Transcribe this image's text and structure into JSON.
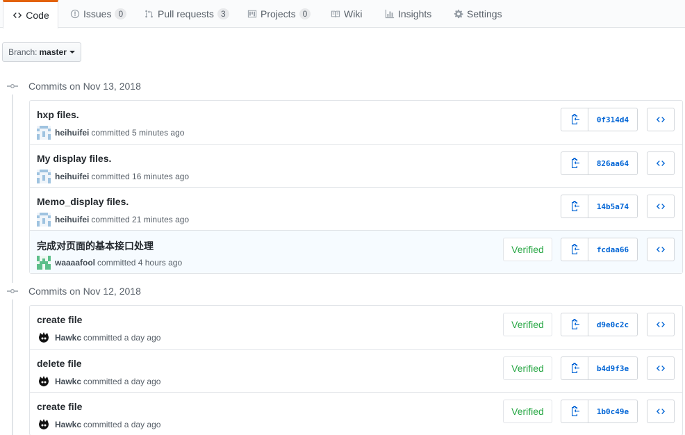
{
  "tabs": {
    "code": "Code",
    "issues": "Issues",
    "issues_count": "0",
    "pulls": "Pull requests",
    "pulls_count": "3",
    "projects": "Projects",
    "projects_count": "0",
    "wiki": "Wiki",
    "insights": "Insights",
    "settings": "Settings"
  },
  "branch": {
    "label": "Branch:",
    "name": "master"
  },
  "groups": [
    {
      "date": "Commits on Nov 13, 2018",
      "commits": [
        {
          "title": "hxp files.",
          "author": "heihuifei",
          "verb": "committed",
          "time": "5 minutes ago",
          "sha": "0f314d4"
        },
        {
          "title": "My display files.",
          "author": "heihuifei",
          "verb": "committed",
          "time": "16 minutes ago",
          "sha": "826aa64"
        },
        {
          "title": "Memo_display files.",
          "author": "heihuifei",
          "verb": "committed",
          "time": "21 minutes ago",
          "sha": "14b5a74"
        },
        {
          "title": "完成对页面的基本接口处理",
          "author": "waaaafool",
          "verb": "committed",
          "time": "4 hours ago",
          "sha": "fcdaa66",
          "verified": "Verified"
        }
      ]
    },
    {
      "date": "Commits on Nov 12, 2018",
      "commits": [
        {
          "title": "create file",
          "author": "Hawkc",
          "verb": "committed",
          "time": "a day ago",
          "sha": "d9e0c2c",
          "verified": "Verified"
        },
        {
          "title": "delete file",
          "author": "Hawkc",
          "verb": "committed",
          "time": "a day ago",
          "sha": "b4d9f3e",
          "verified": "Verified"
        },
        {
          "title": "create file",
          "author": "Hawkc",
          "verb": "committed",
          "time": "a day ago",
          "sha": "1b0c49e",
          "verified": "Verified"
        }
      ]
    }
  ],
  "colors": {
    "accent": "#e36209",
    "link": "#0366d6",
    "verified": "#28a745"
  }
}
